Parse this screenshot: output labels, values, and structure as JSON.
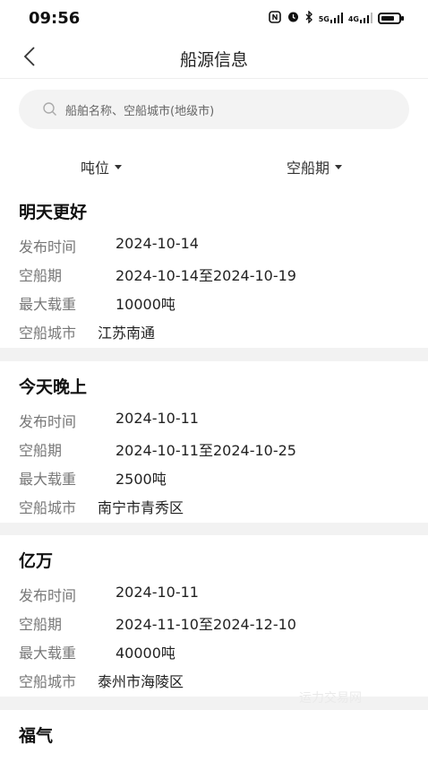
{
  "status_bar": {
    "time": "09:56",
    "icons": [
      "nfc-icon",
      "alarm-icon",
      "bluetooth-icon",
      "signal-5g-icon",
      "signal-4g-icon",
      "battery-icon"
    ],
    "signal_5g": "5G",
    "signal_4g": "4G"
  },
  "nav": {
    "title": "船源信息",
    "back_icon": "chevron-left-icon"
  },
  "search": {
    "placeholder": "船舶名称、空船城市(地级市)"
  },
  "filters": [
    {
      "label": "吨位"
    },
    {
      "label": "空船期"
    }
  ],
  "labels": {
    "publish_time": "发布时间",
    "empty_period": "空船期",
    "max_load": "最大载重",
    "empty_city": "空船城市"
  },
  "cards": [
    {
      "title": "明天更好",
      "publish_time": "2024-10-14",
      "empty_period": "2024-10-14至2024-10-19",
      "max_load": "10000吨",
      "empty_city": "江苏南通"
    },
    {
      "title": "今天晚上",
      "publish_time": "2024-10-11",
      "empty_period": "2024-10-11至2024-10-25",
      "max_load": "2500吨",
      "empty_city": "南宁市青秀区"
    },
    {
      "title": "亿万",
      "publish_time": "2024-10-11",
      "empty_period": "2024-11-10至2024-12-10",
      "max_load": "40000吨",
      "empty_city": "泰州市海陵区"
    },
    {
      "title": "福气"
    }
  ],
  "watermark": "运力交易网",
  "colors": {
    "background": "#f2f2f2",
    "card": "#ffffff",
    "label": "#777777",
    "text": "#222222"
  }
}
